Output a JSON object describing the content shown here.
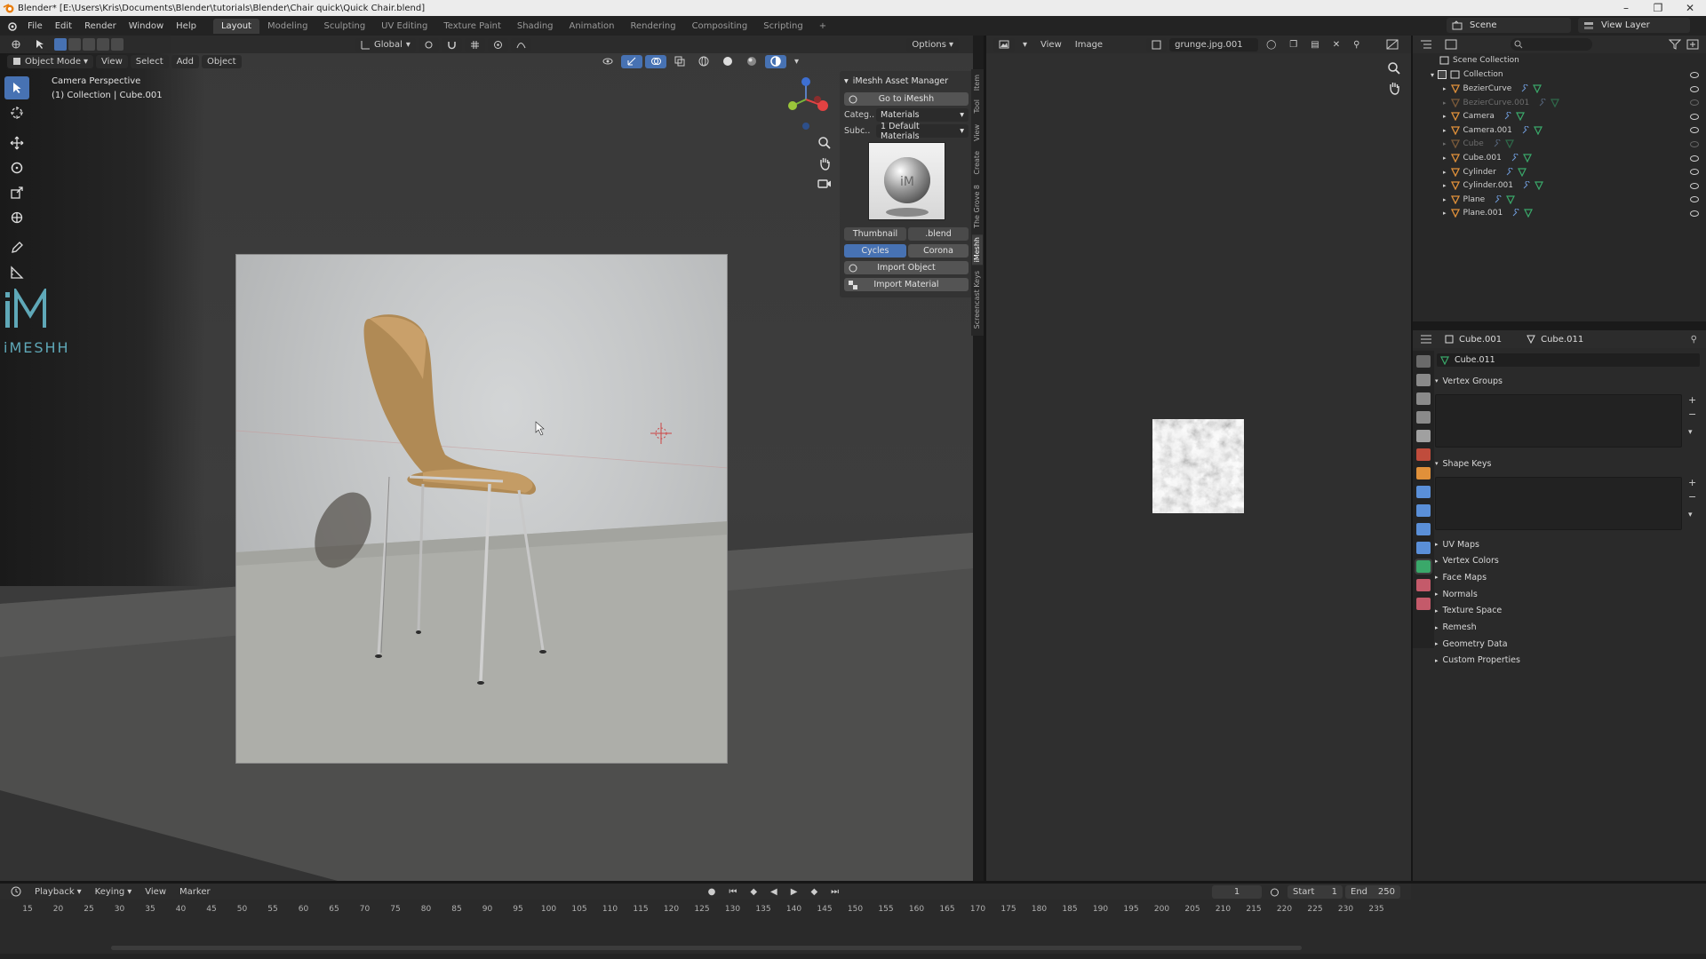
{
  "window": {
    "title": "Blender* [E:\\Users\\Kris\\Documents\\Blender\\tutorials\\Blender\\Chair quick\\Quick Chair.blend]",
    "controls": [
      "–",
      "❐",
      "✕"
    ]
  },
  "topmenu": {
    "menus": [
      "File",
      "Edit",
      "Render",
      "Window",
      "Help"
    ],
    "workspaces": [
      "Layout",
      "Modeling",
      "Sculpting",
      "UV Editing",
      "Texture Paint",
      "Shading",
      "Animation",
      "Rendering",
      "Compositing",
      "Scripting",
      "+"
    ],
    "active_workspace": "Layout",
    "scene": "Scene",
    "view_layer": "View Layer"
  },
  "viewport": {
    "mode": "Object Mode",
    "menus": [
      "View",
      "Select",
      "Add",
      "Object"
    ],
    "transform_orientation": "Global",
    "options": "Options",
    "overlay_title": "Camera Perspective",
    "overlay_subtitle": "(1) Collection | Cube.001",
    "logo_text": "iMESHH"
  },
  "imeshh_panel": {
    "title": "iMeshh Asset Manager",
    "go_button": "Go to iMeshh",
    "category_label": "Categ..",
    "category_value": "Materials",
    "subcategory_label": "Subc..",
    "subcategory_value": "1 Default Materials",
    "thumbnail_label": "Thumbnail",
    "blend_label": ".blend",
    "renderer_options": [
      "Cycles",
      "Corona"
    ],
    "active_renderer": "Cycles",
    "import_object": "Import Object",
    "import_material": "Import Material",
    "side_tabs": [
      "Item",
      "Tool",
      "View",
      "Create",
      "The Grove 8",
      "iMeshh",
      "Screencast Keys"
    ]
  },
  "image_editor": {
    "menus": [
      "View",
      "Image"
    ],
    "image_name": "grunge.jpg.001"
  },
  "outliner": {
    "root": "Scene Collection",
    "collection": "Collection",
    "items": [
      {
        "name": "BezierCurve",
        "dim": false
      },
      {
        "name": "BezierCurve.001",
        "dim": true
      },
      {
        "name": "Camera",
        "dim": false
      },
      {
        "name": "Camera.001",
        "dim": false
      },
      {
        "name": "Cube",
        "dim": true
      },
      {
        "name": "Cube.001",
        "dim": false
      },
      {
        "name": "Cylinder",
        "dim": false
      },
      {
        "name": "Cylinder.001",
        "dim": false
      },
      {
        "name": "Plane",
        "dim": false
      },
      {
        "name": "Plane.001",
        "dim": false
      }
    ]
  },
  "properties": {
    "object_name": "Cube.001",
    "mesh_name": "Cube.011",
    "data_name": "Cube.011",
    "sections_open": [
      "Vertex Groups",
      "Shape Keys"
    ],
    "sections_closed": [
      "UV Maps",
      "Vertex Colors",
      "Face Maps",
      "Normals",
      "Texture Space",
      "Remesh",
      "Geometry Data",
      "Custom Properties"
    ]
  },
  "timeline": {
    "menus": [
      "Playback",
      "Keying",
      "View",
      "Marker"
    ],
    "current_frame": "1",
    "start_label": "Start",
    "start_value": "1",
    "end_label": "End",
    "end_value": "250",
    "ticks": [
      "15",
      "20",
      "25",
      "30",
      "35",
      "40",
      "45",
      "50",
      "55",
      "60",
      "65",
      "70",
      "75",
      "80",
      "85",
      "90",
      "95",
      "100",
      "105",
      "110",
      "115",
      "120",
      "125",
      "130",
      "135",
      "140",
      "145",
      "150",
      "155",
      "160",
      "165",
      "170",
      "175",
      "180",
      "185",
      "190",
      "195",
      "200",
      "205",
      "210",
      "215",
      "220",
      "225",
      "230",
      "235"
    ]
  }
}
